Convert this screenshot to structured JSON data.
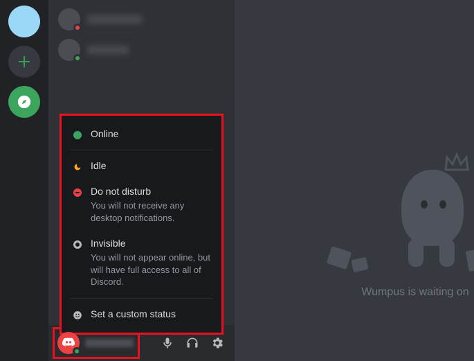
{
  "status_menu": {
    "online": {
      "label": "Online"
    },
    "idle": {
      "label": "Idle"
    },
    "dnd": {
      "label": "Do not disturb",
      "desc": "You will not receive any desktop notifications."
    },
    "invisible": {
      "label": "Invisible",
      "desc": "You will not appear online, but will have full access to all of Discord."
    },
    "custom": {
      "label": "Set a custom status"
    }
  },
  "empty_state": {
    "text": "Wumpus is waiting on"
  },
  "colors": {
    "highlight": "#e8131e",
    "online": "#3ba55d",
    "dnd": "#ed4245"
  }
}
